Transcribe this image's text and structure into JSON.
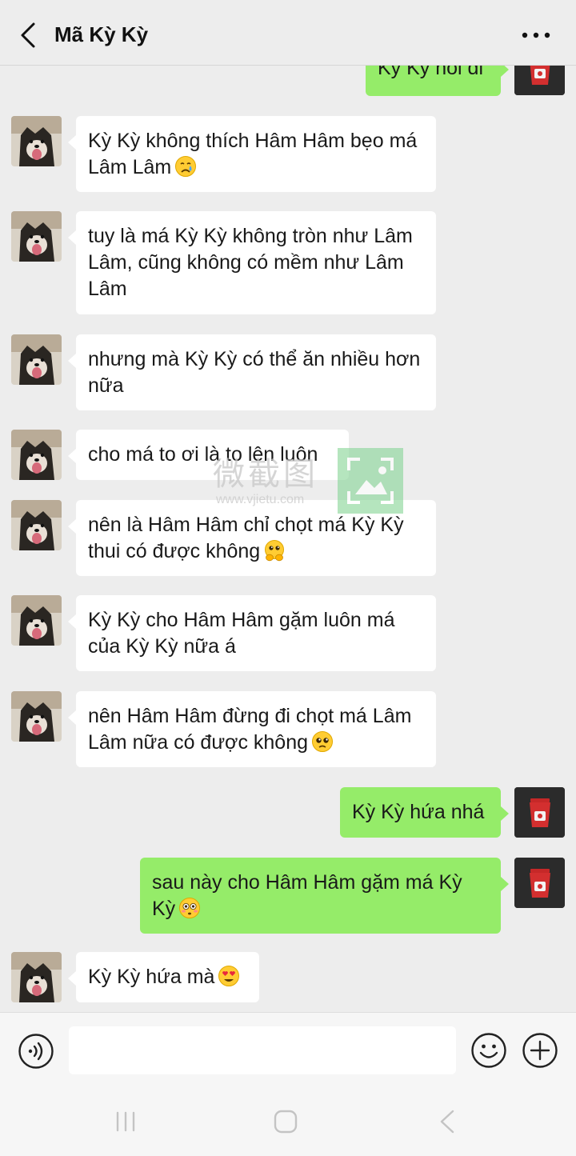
{
  "header": {
    "title": "Mã Kỳ Kỳ"
  },
  "messages": [
    {
      "side": "out",
      "text": "Kỳ Kỳ nói đi",
      "emoji": ""
    },
    {
      "side": "in",
      "text": "Kỳ Kỳ không thích Hâm Hâm bẹo má Lâm Lâm",
      "emoji": "crying-face"
    },
    {
      "side": "in",
      "text": "tuy là má Kỳ Kỳ không tròn như Lâm Lâm, cũng không có mềm như Lâm Lâm",
      "emoji": ""
    },
    {
      "side": "in",
      "text": "nhưng mà Kỳ Kỳ có thể ăn nhiều hơn nữa",
      "emoji": ""
    },
    {
      "side": "in",
      "text": "cho má to ơi là to lên luôn",
      "emoji": ""
    },
    {
      "side": "in",
      "text": "nên là Hâm Hâm chỉ chọt má Kỳ Kỳ thui có được không",
      "emoji": "pleading-hands-face"
    },
    {
      "side": "in",
      "text": "Kỳ Kỳ cho Hâm Hâm gặm luôn má của Kỳ Kỳ nữa á",
      "emoji": ""
    },
    {
      "side": "in",
      "text": "nên Hâm Hâm đừng đi chọt má Lâm Lâm nữa có được không",
      "emoji": "pleading-face"
    },
    {
      "side": "out",
      "text": "Kỳ Kỳ hứa nhá",
      "emoji": ""
    },
    {
      "side": "out",
      "text": "sau này cho Hâm Hâm gặm má Kỳ Kỳ",
      "emoji": "flushed-face"
    },
    {
      "side": "in",
      "text": "Kỳ Kỳ hứa mà",
      "emoji": "heart-eyes-face"
    }
  ],
  "watermark": {
    "text": "微截图",
    "url": "www.vjietu.com"
  },
  "input": {
    "value": "",
    "placeholder": ""
  },
  "colors": {
    "background": "#ededed",
    "incoming_bubble": "#ffffff",
    "outgoing_bubble": "#95ec69"
  }
}
